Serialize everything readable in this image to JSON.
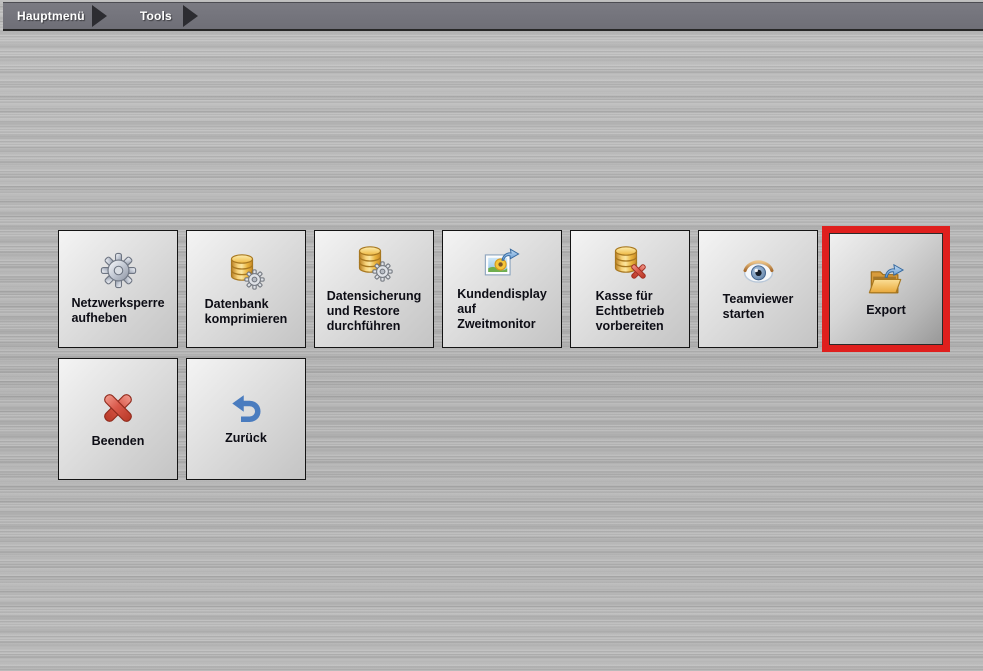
{
  "breadcrumb": {
    "items": [
      {
        "label": "Hauptmenü"
      },
      {
        "label": "Tools"
      }
    ]
  },
  "tools_grid": {
    "buttons": [
      {
        "id": "netzwerksperre-aufheben",
        "label": "Netzwerksperre\naufheben",
        "icon": "gear-icon"
      },
      {
        "id": "datenbank-komprimieren",
        "label": "Datenbank\nkomprimieren",
        "icon": "database-gear-icon"
      },
      {
        "id": "datensicherung-restore",
        "label": "Datensicherung\nund Restore\ndurchführen",
        "icon": "database-gear-icon"
      },
      {
        "id": "kundendisplay-zweitmonitor",
        "label": "Kundendisplay\nauf\nZweitmonitor",
        "icon": "image-export-icon"
      },
      {
        "id": "kasse-echtbetrieb",
        "label": "Kasse für\nEchtbetrieb\nvorbereiten",
        "icon": "database-delete-icon"
      },
      {
        "id": "teamviewer-starten",
        "label": "Teamviewer\nstarten",
        "icon": "eye-icon"
      },
      {
        "id": "export",
        "label": "Export",
        "icon": "folder-export-icon",
        "highlighted": true
      }
    ],
    "nav_buttons": [
      {
        "id": "beenden",
        "label": "Beenden",
        "icon": "close-x-icon"
      },
      {
        "id": "zurueck",
        "label": "Zurück",
        "icon": "back-arrow-icon"
      }
    ]
  },
  "colors": {
    "highlight_border": "#df1f1d",
    "breadcrumb_bar": "#73737b",
    "button_text": "#0d0d15",
    "gold_icon": "#eab43e",
    "blue_icon": "#4a7cbf",
    "red_icon": "#c9473a"
  }
}
